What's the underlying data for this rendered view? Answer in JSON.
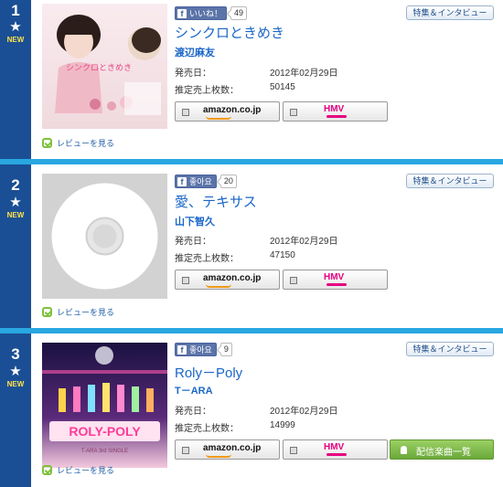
{
  "entries": [
    {
      "rank": "1",
      "star": "★",
      "new_label": "NEW",
      "like_label": "いいね！",
      "like_count": "49",
      "feature_label": "特集＆インタビュー",
      "title": "シンクロときめき",
      "artist": "渡辺麻友",
      "release_label": "発売日：",
      "release_value": "2012年02月29日",
      "sales_label": "推定売上枚数：",
      "sales_value": "50145",
      "amazon_label": "amazon.co.jp",
      "hmv_label": "HMV",
      "review_label": "レビューを見る",
      "cover_text": "シンクロときめき"
    },
    {
      "rank": "2",
      "star": "★",
      "new_label": "NEW",
      "like_label": "좋아요",
      "like_count": "20",
      "feature_label": "特集＆インタビュー",
      "title": "愛、テキサス",
      "artist": "山下智久",
      "release_label": "発売日：",
      "release_value": "2012年02月29日",
      "sales_label": "推定売上枚数：",
      "sales_value": "47150",
      "amazon_label": "amazon.co.jp",
      "hmv_label": "HMV",
      "review_label": "レビューを見る"
    },
    {
      "rank": "3",
      "star": "★",
      "new_label": "NEW",
      "like_label": "좋아요",
      "like_count": "9",
      "feature_label": "特集＆インタビュー",
      "title": "Roly－Poly",
      "artist": "T－ARA",
      "release_label": "発売日：",
      "release_value": "2012年02月29日",
      "sales_label": "推定売上枚数：",
      "sales_value": "14999",
      "amazon_label": "amazon.co.jp",
      "hmv_label": "HMV",
      "dist_label": "配信楽曲一覧",
      "review_label": "レビューを見る",
      "cover_title": "ROLY-POLY",
      "cover_sub": "T-ARA 3rd SINGLE"
    }
  ],
  "colors": {
    "divider": "#29a7e1",
    "rank_bg": "#1b4f95",
    "title": "#1a66c8"
  }
}
